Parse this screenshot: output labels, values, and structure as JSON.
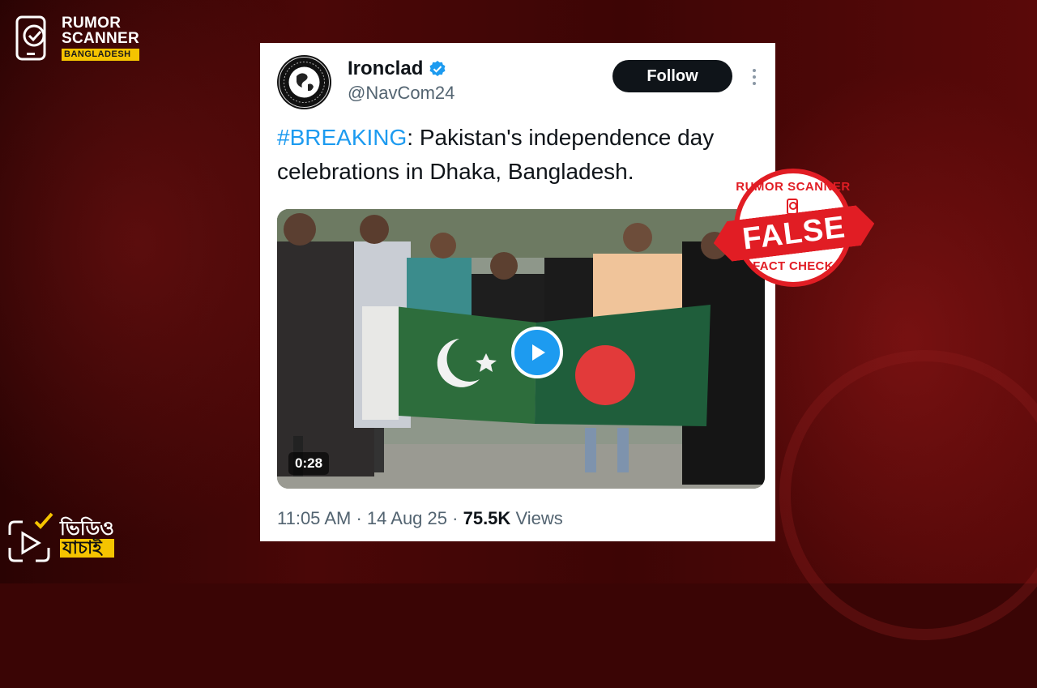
{
  "brand": {
    "line1": "RUMOR",
    "line2": "SCANNER",
    "line3": "BANGLADESH"
  },
  "tweet": {
    "name": "Ironclad",
    "handle": "@NavCom24",
    "follow_label": "Follow",
    "hashtag": "#BREAKING",
    "body": ": Pakistan's independence day celebrations in Dhaka, Bangladesh.",
    "video_duration": "0:28",
    "time": "11:05 AM",
    "date": "14 Aug 25",
    "views_count": "75.5K",
    "views_label": "Views",
    "separator": "·"
  },
  "stamp": {
    "top": "RUMOR SCANNER",
    "verdict": "FALSE",
    "bottom": "FACT CHECK"
  },
  "video_badge": {
    "line1": "ভিডিও",
    "line2": "যাচাই"
  },
  "colors": {
    "verified": "#1d9bf0",
    "hashtag": "#1d9bf0",
    "stamp_red": "#e11d24",
    "brand_yellow": "#f5c400"
  },
  "icons": [
    "phone-check-icon",
    "verified-badge-icon",
    "more-options-icon",
    "play-icon",
    "video-play-check-icon"
  ]
}
